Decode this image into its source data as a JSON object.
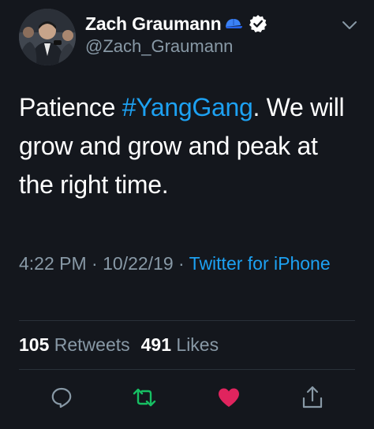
{
  "author": {
    "display_name": "Zach Graumann",
    "handle": "@Zach_Graumann"
  },
  "tweet": {
    "text_before": "Patience ",
    "hashtag": "#YangGang",
    "text_after": ". We will grow and grow and peak at the right time."
  },
  "meta": {
    "time": "4:22 PM",
    "separator": " · ",
    "date": "10/22/19",
    "source": "Twitter for iPhone"
  },
  "stats": {
    "retweets_count": "105",
    "retweets_label": "Retweets",
    "likes_count": "491",
    "likes_label": "Likes"
  },
  "actions": [
    "reply-icon",
    "retweet-icon",
    "like-icon",
    "share-icon"
  ],
  "colors": {
    "background": "#14171d",
    "link": "#1da1f2",
    "secondary_text": "#8899a6",
    "retweet": "#17bf63",
    "like": "#e0245e"
  }
}
